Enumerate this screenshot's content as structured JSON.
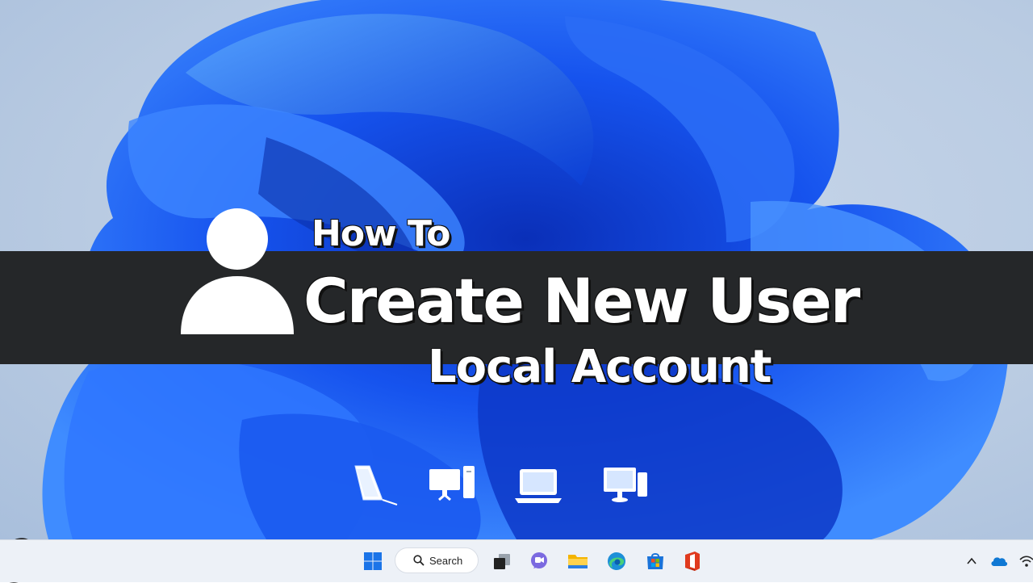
{
  "thumbnail": {
    "line1": "How To",
    "line2": "Create New User",
    "line3": "Local Account"
  },
  "devices": [
    "tablet-icon",
    "desktop-tower-icon",
    "laptop-icon",
    "desktop-pc-icon"
  ],
  "taskbar": {
    "search_label": "Search",
    "apps": [
      "start-icon",
      "task-view-icon",
      "teams-chat-icon",
      "file-explorer-icon",
      "edge-icon",
      "store-icon",
      "office-icon"
    ],
    "tray": [
      "chevron-up-icon",
      "onedrive-icon",
      "wifi-icon"
    ]
  },
  "colors": {
    "banner": "#252729",
    "taskbar": "#edf1f7",
    "bloom": "#1a5cf0"
  }
}
